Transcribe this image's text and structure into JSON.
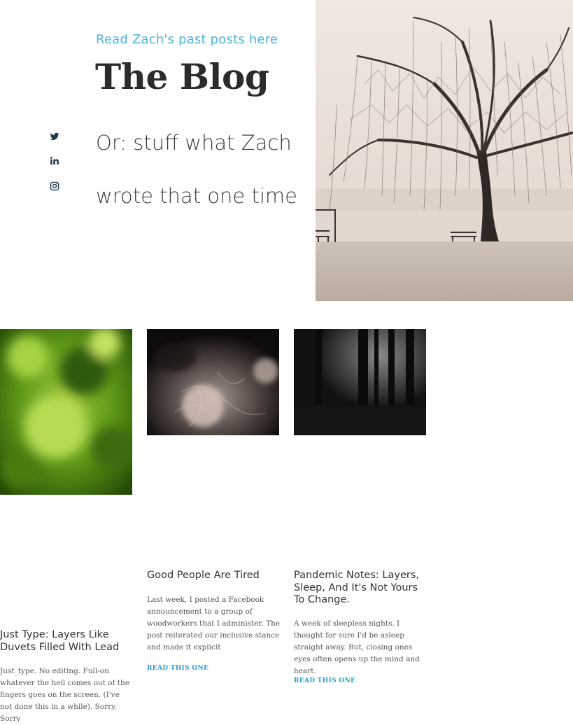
{
  "hero": {
    "kicker": "Read Zach's past posts here",
    "title": "The Blog",
    "subtitle": "Or: stuff what Zach wrote that one time"
  },
  "social": [
    {
      "icon": "twitter-icon"
    },
    {
      "icon": "linkedin-icon"
    },
    {
      "icon": "instagram-icon"
    }
  ],
  "posts": [
    {
      "title": "Just Type: Layers Like Duvets Filled With Lead",
      "excerpt": "Just_type. No editing. Full-on whatever the hell comes out of the fingers goes on the screen. (I've not done this in a while). Sorry. Sorry",
      "read_more": ""
    },
    {
      "title": "Good People Are Tired",
      "excerpt": "Last week, I posted a Facebook announcement to a group of woodworkers that I administer. The post reiterated our inclusive stance and made it explicit",
      "read_more": "READ THIS ONE"
    },
    {
      "title": "Pandemic Notes: Layers, Sleep, And It's Not Yours To Change.",
      "excerpt": "A week of sleepless nights. I thought for sure I'd be asleep straight away. But, closing ones eyes often opens up the mind and heart.",
      "read_more": "READ THIS ONE"
    }
  ],
  "colors": {
    "accent": "#4eb3dd",
    "link": "#2a9fd6",
    "social": "#1b3b4f"
  }
}
